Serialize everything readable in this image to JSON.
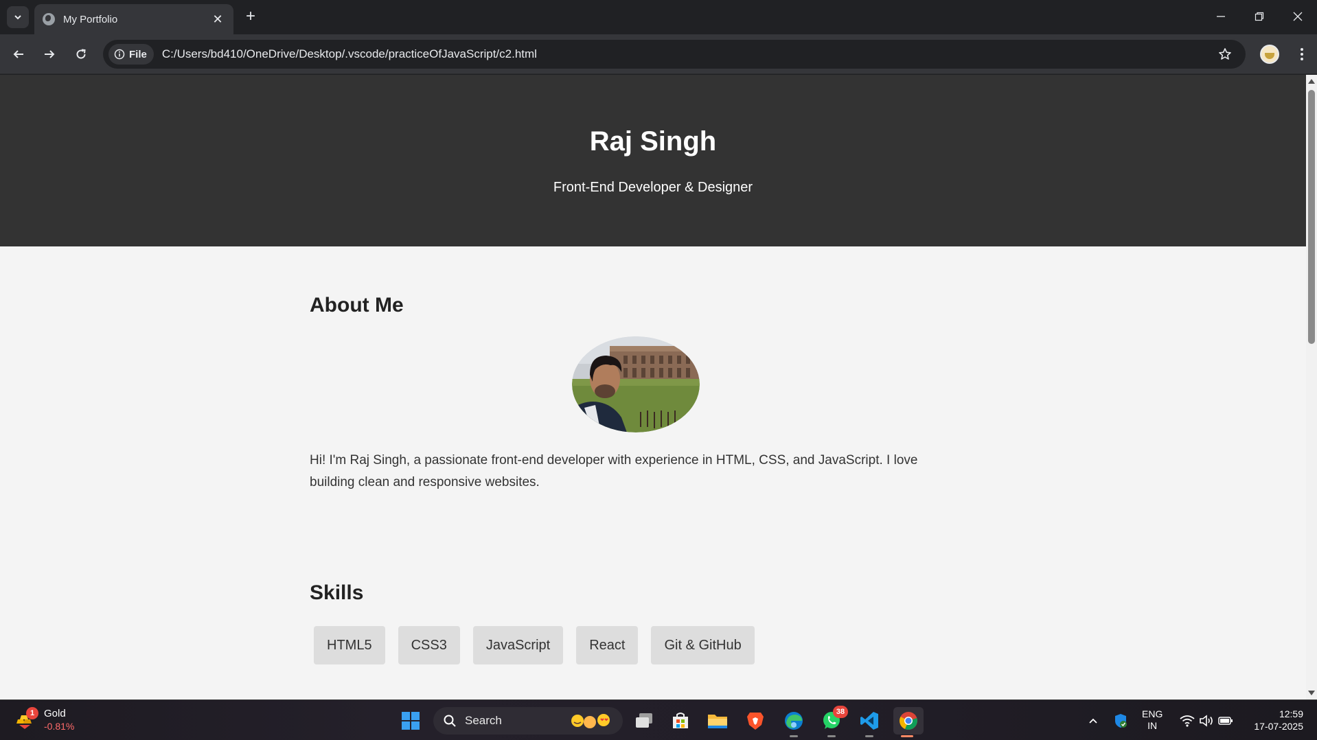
{
  "browser": {
    "tab_title": "My Portfolio",
    "url_chip": "File",
    "url": "C:/Users/bd410/OneDrive/Desktop/.vscode/practiceOfJavaScript/c2.html"
  },
  "page": {
    "name": "Raj Singh",
    "tagline": "Front-End Developer & Designer",
    "about_heading": "About Me",
    "about_text": "Hi! I'm Raj Singh, a passionate front-end developer with experience in HTML, CSS, and JavaScript. I love building clean and responsive websites.",
    "skills_heading": "Skills",
    "skills": [
      "HTML5",
      "CSS3",
      "JavaScript",
      "React",
      "Git & GitHub"
    ]
  },
  "taskbar": {
    "widget_name": "Gold",
    "widget_change": "-0.81%",
    "widget_badge": "1",
    "search_label": "Search",
    "whatsapp_badge": "38",
    "lang": "ENG",
    "region": "IN",
    "time": "12:59",
    "date": "17-07-2025"
  },
  "colors": {
    "hero_bg": "#333333",
    "page_bg": "#f4f4f4",
    "skill_bg": "#dddddd",
    "change_negative": "#ff6b6b"
  }
}
